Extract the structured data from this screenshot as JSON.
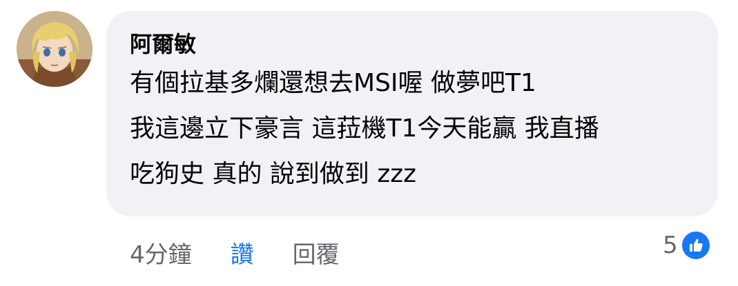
{
  "comment": {
    "author": "阿爾敏",
    "lines": [
      "有個拉基多爛還想去MSI喔 做夢吧T1",
      "我這邊立下豪言 這菈機T1今天能贏 我直播",
      "吃狗史 真的 說到做到 zzz"
    ]
  },
  "actions": {
    "time": "4分鐘",
    "like_label": "讚",
    "reply_label": "回覆"
  },
  "reactions": {
    "count": "5",
    "icon": "thumbs-up-icon"
  },
  "colors": {
    "bubble": "#f0f2f5",
    "like_active": "#1877f2",
    "secondary_text": "#65676b"
  }
}
